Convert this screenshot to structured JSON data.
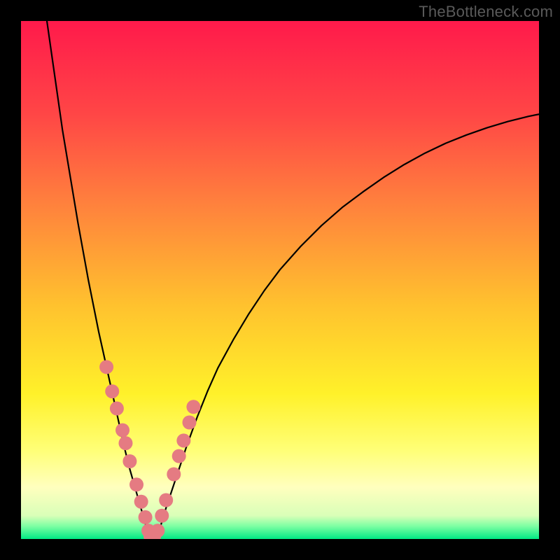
{
  "watermark": "TheBottleneck.com",
  "chart_data": {
    "type": "line",
    "title": "",
    "xlabel": "",
    "ylabel": "",
    "xlim": [
      0,
      100
    ],
    "ylim": [
      0,
      100
    ],
    "grid": false,
    "legend": false,
    "background_gradient": [
      {
        "stop": 0.0,
        "color": "#ff1a4b"
      },
      {
        "stop": 0.18,
        "color": "#ff4646"
      },
      {
        "stop": 0.35,
        "color": "#ff803d"
      },
      {
        "stop": 0.55,
        "color": "#ffc22e"
      },
      {
        "stop": 0.72,
        "color": "#fff12a"
      },
      {
        "stop": 0.83,
        "color": "#ffff78"
      },
      {
        "stop": 0.9,
        "color": "#ffffbe"
      },
      {
        "stop": 0.955,
        "color": "#d9ffb8"
      },
      {
        "stop": 0.975,
        "color": "#7effa3"
      },
      {
        "stop": 1.0,
        "color": "#00e884"
      }
    ],
    "series": [
      {
        "name": "left-curve",
        "stroke": "#000000",
        "stroke_width": 2.2,
        "x": [
          5,
          6,
          7,
          8,
          9,
          10,
          11,
          12,
          13,
          14,
          15,
          16,
          17,
          18,
          19,
          20,
          21,
          22,
          23,
          24,
          24.8
        ],
        "y": [
          100,
          93,
          86,
          79,
          73,
          67,
          61,
          55.5,
          50,
          45,
          40,
          35.5,
          31,
          26.5,
          22,
          17.5,
          13.5,
          10,
          6.5,
          3,
          0
        ]
      },
      {
        "name": "right-curve",
        "stroke": "#000000",
        "stroke_width": 2.2,
        "x": [
          26.2,
          28,
          30,
          32,
          34,
          36,
          38,
          41,
          44,
          47,
          50,
          54,
          58,
          62,
          66,
          70,
          74,
          78,
          82,
          86,
          90,
          94,
          98,
          100
        ],
        "y": [
          0,
          6,
          12,
          18,
          23.5,
          28.5,
          33,
          38.5,
          43.5,
          48,
          52,
          56.5,
          60.5,
          64,
          67,
          69.8,
          72.3,
          74.5,
          76.4,
          78,
          79.4,
          80.6,
          81.6,
          82
        ]
      },
      {
        "name": "left-dots",
        "type": "scatter",
        "marker_color": "#e57b82",
        "marker_radius": 10,
        "x": [
          16.5,
          17.6,
          18.5,
          19.6,
          20.2,
          21.0,
          22.3,
          23.2,
          24.0,
          24.6
        ],
        "y": [
          33.2,
          28.5,
          25.2,
          21.0,
          18.5,
          15.0,
          10.5,
          7.2,
          4.2,
          1.6
        ]
      },
      {
        "name": "right-dots",
        "type": "scatter",
        "marker_color": "#e57b82",
        "marker_radius": 10,
        "x": [
          26.4,
          27.2,
          28.0,
          29.5,
          30.5,
          31.4,
          32.5,
          33.3
        ],
        "y": [
          1.6,
          4.5,
          7.5,
          12.5,
          16.0,
          19.0,
          22.5,
          25.5
        ]
      },
      {
        "name": "bottom-dots",
        "type": "scatter",
        "marker_color": "#e57b82",
        "marker_radius": 10,
        "x": [
          25.0,
          25.7
        ],
        "y": [
          0.5,
          0.5
        ]
      }
    ]
  }
}
